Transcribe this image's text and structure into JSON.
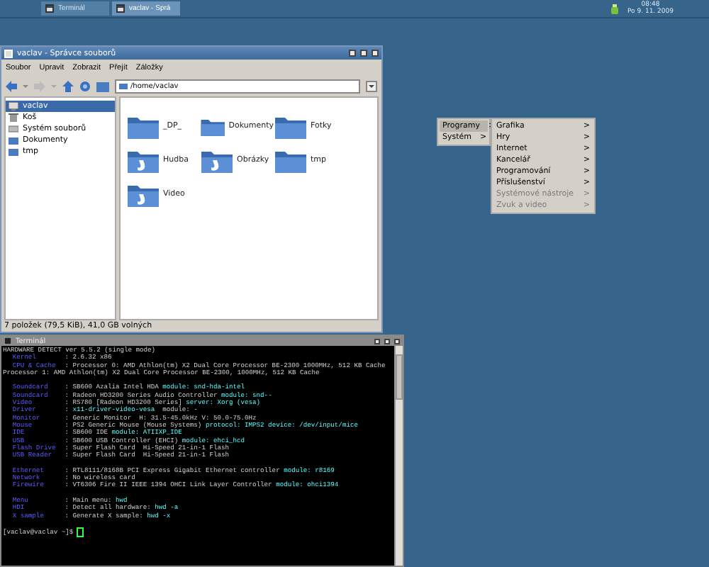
{
  "taskbar": {
    "tasks": [
      {
        "label": "Terminál",
        "selected": false
      },
      {
        "label": "vaclav - Sprá",
        "selected": true
      }
    ],
    "clock": {
      "time": "08:48",
      "date": "Po 9. 11. 2009"
    }
  },
  "file_manager": {
    "title": "vaclav - Správce souborů",
    "menu": [
      "Soubor",
      "Upravit",
      "Zobrazit",
      "Přejít",
      "Záložky"
    ],
    "location": "/home/vaclav",
    "sidebar": [
      {
        "label": "vaclav",
        "kind": "home",
        "selected": true
      },
      {
        "label": "Koš",
        "kind": "trash",
        "selected": false
      },
      {
        "label": "Systém souborů",
        "kind": "drive",
        "selected": false
      },
      {
        "label": "Dokumenty",
        "kind": "folder",
        "selected": false
      },
      {
        "label": "tmp",
        "kind": "folder",
        "selected": false
      }
    ],
    "items": [
      {
        "name": "_DP_",
        "kind": "plain"
      },
      {
        "name": "Dokumenty",
        "kind": "plain"
      },
      {
        "name": "Fotky",
        "kind": "plain"
      },
      {
        "name": "Hudba",
        "kind": "special"
      },
      {
        "name": "Obrázky",
        "kind": "special"
      },
      {
        "name": "tmp",
        "kind": "plain"
      },
      {
        "name": "Video",
        "kind": "special"
      }
    ],
    "status_bar": "7 položek (79,5 KiB), 41,0 GB volných"
  },
  "menu": {
    "items": [
      {
        "label": "Programy",
        "selected": true
      },
      {
        "label": "Systém",
        "selected": false
      }
    ],
    "submenu": [
      {
        "label": "Grafika",
        "disabled": false
      },
      {
        "label": "Hry",
        "disabled": false
      },
      {
        "label": "Internet",
        "disabled": false
      },
      {
        "label": "Kancelář",
        "disabled": false
      },
      {
        "label": "Programování",
        "disabled": false
      },
      {
        "label": "Příslušenství",
        "disabled": false
      },
      {
        "label": "Systémové nástroje",
        "disabled": true
      },
      {
        "label": "Zvuk a video",
        "disabled": true
      }
    ],
    "arrow": ">"
  },
  "terminal": {
    "title": "Terminál",
    "sections": [
      [
        {
          "parts": [
            {
              "text": "HARDWARE DETECT ver 5.5.2 (single mode)",
              "hl": false
            }
          ]
        },
        {
          "label": "Kernel",
          "parts": [
            {
              "text": "2.6.32 x86",
              "hl": false
            }
          ]
        },
        {
          "label": "CPU & Cache",
          "parts": [
            {
              "text": "Processor 0: AMD Athlon(tm) X2 Dual Core Processor BE-2300 1000MHz, 512 KB Cache",
              "hl": false
            }
          ]
        },
        {
          "parts": [
            {
              "text": "Processor 1: AMD Athlon(tm) X2 Dual Core Processor BE-2300, 1000MHz, 512 KB Cache",
              "hl": false
            }
          ]
        }
      ],
      [
        {
          "label": "Soundcard",
          "parts": [
            {
              "text": "SB600 Azalia Intel HDA ",
              "hl": false
            },
            {
              "text": "module: snd-hda-intel",
              "hl": true
            }
          ]
        },
        {
          "label": "Soundcard",
          "parts": [
            {
              "text": "Radeon HD3200 Series Audio Controller ",
              "hl": false
            },
            {
              "text": "module: snd--",
              "hl": true
            }
          ]
        },
        {
          "label": "Video",
          "parts": [
            {
              "text": "RS780 [Radeon HD3200 Series] ",
              "hl": false
            },
            {
              "text": "server: Xorg (vesa)",
              "hl": true
            }
          ]
        },
        {
          "label": "Driver",
          "parts": [
            {
              "text": "x11-driver-video-vesa",
              "hl": true
            },
            {
              "text": "  module: -",
              "hl": false
            }
          ]
        },
        {
          "label": "Monitor",
          "parts": [
            {
              "text": "Generic Monitor  H: 31.5-45.0kHz V: 50.0-75.0Hz",
              "hl": false
            }
          ]
        },
        {
          "label": "Mouse",
          "parts": [
            {
              "text": "PS2 Generic Mouse (Mouse Systems) ",
              "hl": false
            },
            {
              "text": "protocol: IMPS2 device: /dev/input/mice",
              "hl": true
            }
          ]
        },
        {
          "label": "IDE",
          "parts": [
            {
              "text": "SB600 IDE ",
              "hl": false
            },
            {
              "text": "module: ATIIXP_IDE",
              "hl": true
            }
          ]
        },
        {
          "label": "USB",
          "parts": [
            {
              "text": "SB600 USB Controller (EHCI) ",
              "hl": false
            },
            {
              "text": "module: ehci_hcd",
              "hl": true
            }
          ]
        },
        {
          "label": "Flash Drive",
          "parts": [
            {
              "text": "Super Flash Card  Hi-Speed 21-in-1 Flash",
              "hl": false
            }
          ]
        },
        {
          "label": "USB Reader",
          "parts": [
            {
              "text": "Super Flash Card  Hi-Speed 21-in-1 Flash",
              "hl": false
            }
          ]
        }
      ],
      [
        {
          "label": "Ethernet",
          "parts": [
            {
              "text": "RTL8111/8168B PCI Express Gigabit Ethernet controller ",
              "hl": false
            },
            {
              "text": "module: r8169",
              "hl": true
            }
          ]
        },
        {
          "label": "Network",
          "parts": [
            {
              "text": "No wireless card",
              "hl": false
            }
          ]
        },
        {
          "label": "Firewire",
          "parts": [
            {
              "text": "VT6306 Fire II IEEE 1394 OHCI Link Layer Controller ",
              "hl": false
            },
            {
              "text": "module: ohci1394",
              "hl": true
            }
          ]
        }
      ],
      [
        {
          "label": "Menu",
          "parts": [
            {
              "text": "Main menu: ",
              "hl": false
            },
            {
              "text": "hwd",
              "hl": true
            }
          ]
        },
        {
          "label": "HDI",
          "parts": [
            {
              "text": "Detect all hardware: ",
              "hl": false
            },
            {
              "text": "hwd -a",
              "hl": true
            }
          ]
        },
        {
          "label": "X sample",
          "parts": [
            {
              "text": "Generate X sample: ",
              "hl": false
            },
            {
              "text": "hwd -x",
              "hl": true
            }
          ]
        }
      ]
    ],
    "separator": ":",
    "prompt": "[vaclav@vaclav ~]$ "
  }
}
